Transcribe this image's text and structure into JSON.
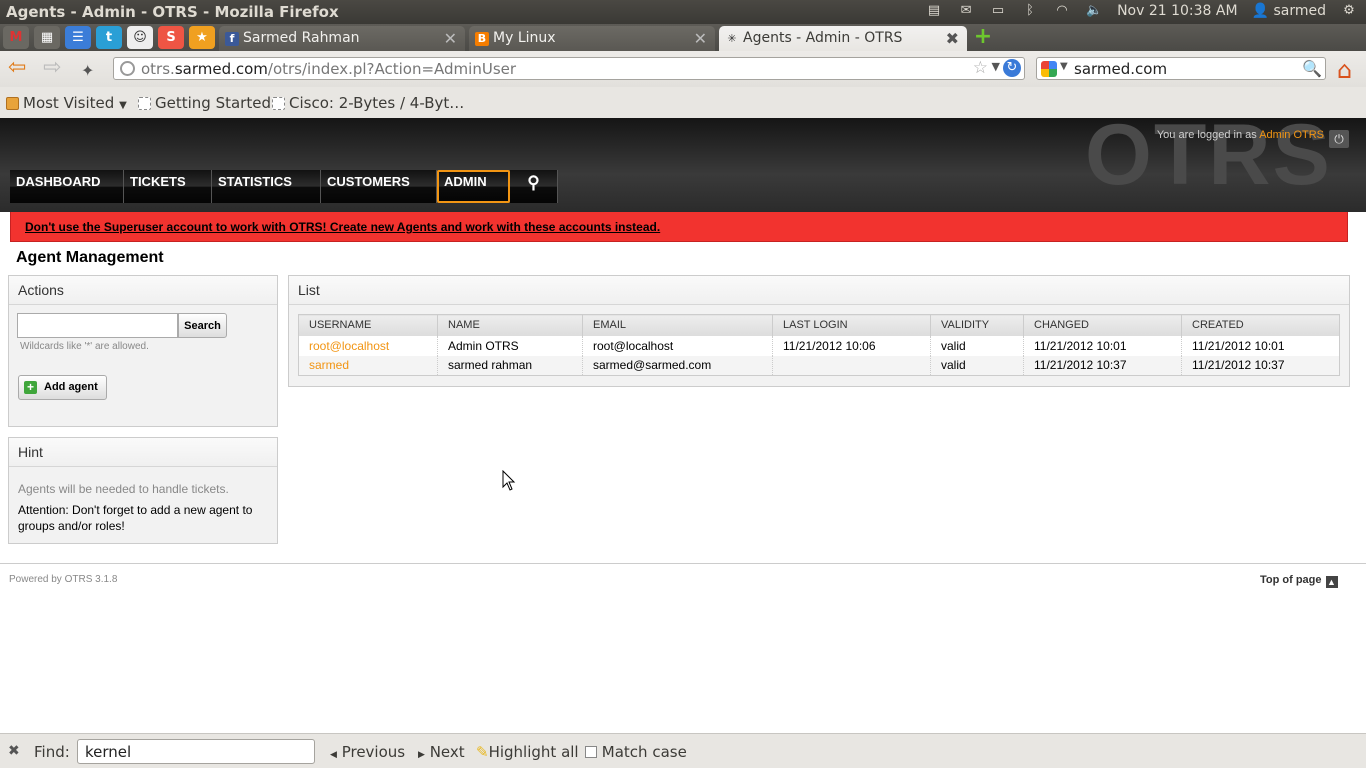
{
  "panel": {
    "window_title": "Agents - Admin - OTRS - Mozilla Firefox",
    "datetime": "Nov 21 10:38 AM",
    "user": "sarmed"
  },
  "tabs": [
    {
      "label": "Sarmed Rahman",
      "favicon": "f",
      "color": "#3b5998"
    },
    {
      "label": "My Linux",
      "favicon": "B",
      "color": "#f57d00"
    },
    {
      "label": "Agents - Admin - OTRS",
      "favicon": "✳",
      "color": "#777777"
    }
  ],
  "app_tabs": [
    "M",
    "▦",
    "🐦",
    "☺",
    "S",
    "★"
  ],
  "nav": {
    "url_prefix": "otrs.",
    "url_domain": "sarmed.com",
    "url_suffix": "/otrs/index.pl?Action=AdminUser",
    "search_value": "sarmed.com"
  },
  "bookmarks": {
    "most_visited": "Most Visited",
    "getting_started": "Getting Started",
    "cisco": "Cisco: 2-Bytes / 4-Byt…"
  },
  "otrs": {
    "logo": "OTRS",
    "logged_in_text": "You are logged in as",
    "logged_in_user": "Admin OTRS",
    "menu": [
      "DASHBOARD",
      "TICKETS",
      "STATISTICS",
      "CUSTOMERS",
      "ADMIN"
    ],
    "notice": "Don't use the Superuser account to work with OTRS! Create new Agents and work with these accounts instead.",
    "page_title": "Agent Management",
    "actions": {
      "title": "Actions",
      "search_button": "Search",
      "wildcard_hint": "Wildcards like '*' are allowed.",
      "add_agent": "Add agent"
    },
    "hint": {
      "title": "Hint",
      "text1": "Agents will be needed to handle tickets.",
      "text2": "Attention: Don't forget to add a new agent to groups and/or roles!"
    },
    "list": {
      "title": "List",
      "columns": [
        "USERNAME",
        "NAME",
        "EMAIL",
        "LAST LOGIN",
        "VALIDITY",
        "CHANGED",
        "CREATED"
      ],
      "rows": [
        [
          "root@localhost",
          "Admin OTRS",
          "root@localhost",
          "11/21/2012 10:06",
          "valid",
          "11/21/2012 10:01",
          "11/21/2012 10:01"
        ],
        [
          "sarmed",
          "sarmed rahman",
          "sarmed@sarmed.com",
          "",
          "valid",
          "11/21/2012 10:37",
          "11/21/2012 10:37"
        ]
      ]
    },
    "footer": {
      "powered": "Powered by OTRS 3.1.8",
      "top_of_page": "Top of page"
    }
  },
  "findbar": {
    "label": "Find:",
    "value": "kernel",
    "previous": "Previous",
    "next": "Next",
    "highlight_all": "Highlight all",
    "match_case": "Match case"
  }
}
